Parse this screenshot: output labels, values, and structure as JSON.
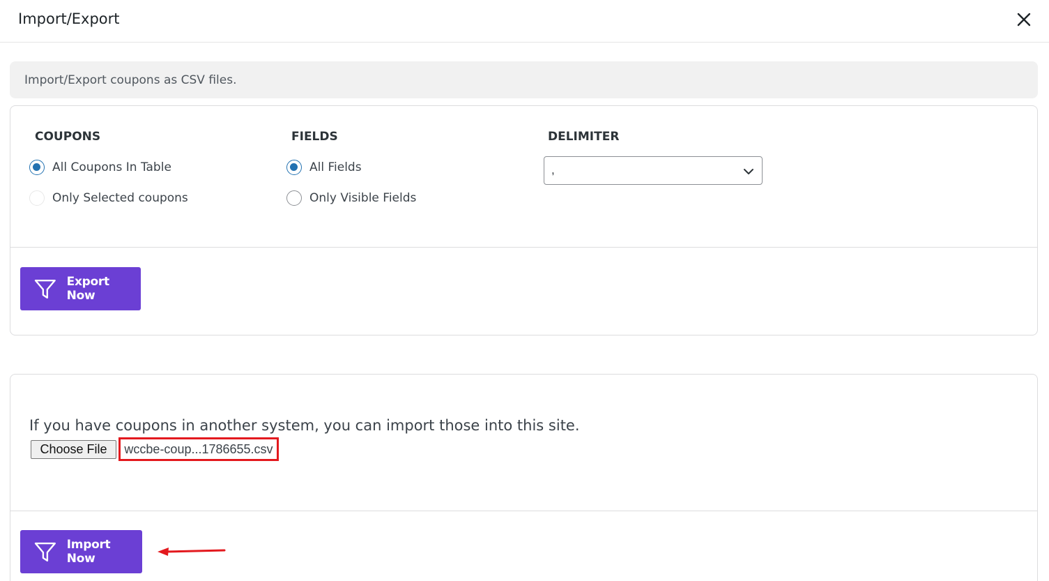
{
  "modal": {
    "title": "Import/Export"
  },
  "notice": {
    "text": "Import/Export coupons as CSV files."
  },
  "export": {
    "coupons": {
      "title": "COUPONS",
      "options": [
        {
          "label": "All Coupons In Table",
          "checked": true
        },
        {
          "label": "Only Selected coupons",
          "checked": false
        }
      ]
    },
    "fields": {
      "title": "FIELDS",
      "options": [
        {
          "label": "All Fields",
          "checked": true
        },
        {
          "label": "Only Visible Fields",
          "checked": false
        }
      ]
    },
    "delimiter": {
      "title": "DELIMITER",
      "value": ","
    },
    "button_label": "Export Now"
  },
  "import": {
    "description": "If you have coupons in another system, you can import those into this site.",
    "choose_file_label": "Choose File",
    "file_name": "wccbe-coup...1786655.csv",
    "button_label": "Import Now"
  },
  "colors": {
    "accent": "#6b3fd4",
    "radio_checked": "#2271b1",
    "highlight": "#e3191e"
  }
}
